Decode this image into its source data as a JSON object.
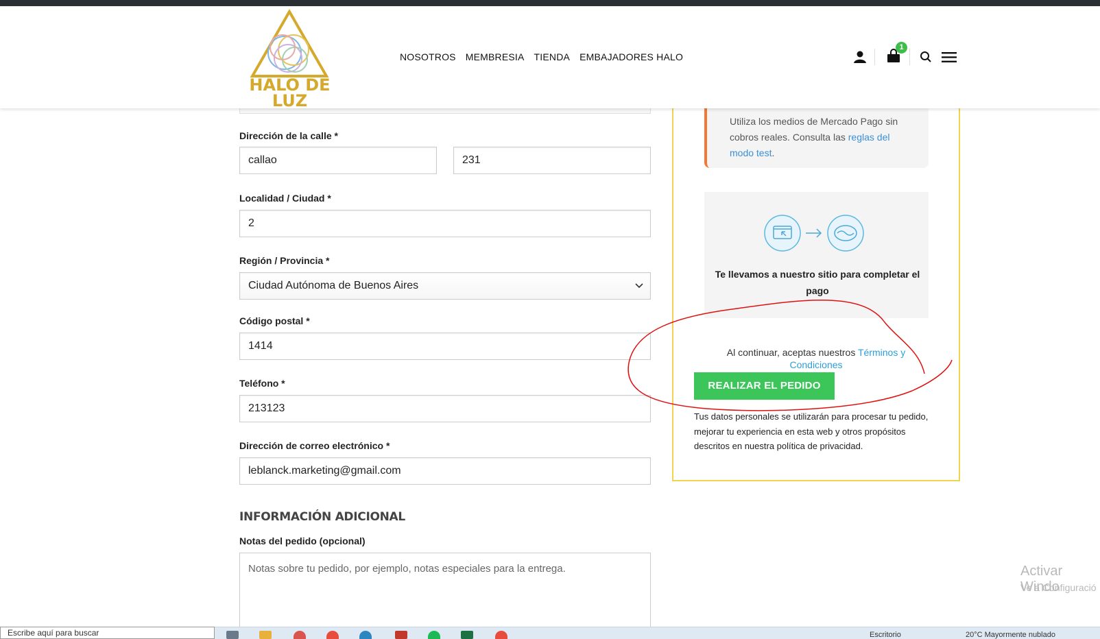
{
  "header": {
    "logo_line1": "HALO DE",
    "logo_line2": "LUZ",
    "nav": [
      "NOSOTROS",
      "MEMBRESIA",
      "TIENDA",
      "EMBAJADORES HALO"
    ],
    "cart_count": "1"
  },
  "form": {
    "street_label": "Dirección de la calle *",
    "street_value": "callao",
    "street_number_value": "231",
    "city_label": "Localidad / Ciudad *",
    "city_value": "2",
    "region_label": "Región / Provincia *",
    "region_value": "Ciudad Autónoma de Buenos Aires",
    "postcode_label": "Código postal *",
    "postcode_value": "1414",
    "phone_label": "Teléfono *",
    "phone_value": "213123",
    "email_label": "Dirección de correo electrónico *",
    "email_value": "leblanck.marketing@gmail.com",
    "additional_title": "INFORMACIÓN ADICIONAL",
    "notes_label": "Notas del pedido (opcional)",
    "notes_placeholder": "Notas sobre tu pedido, por ejemplo, notas especiales para la entrega."
  },
  "payment": {
    "test_text": "Utiliza los medios de Mercado Pago sin cobros reales. Consulta las ",
    "test_link": "reglas del modo test",
    "test_end": ".",
    "redirect_text": "Te llevamos a nuestro sitio para completar el pago",
    "terms_text": "Al continuar, aceptas nuestros ",
    "terms_link": "Términos y Condiciones",
    "place_order": "REALIZAR EL PEDIDO",
    "privacy": "Tus datos personales se utilizarán para procesar tu pedido, mejorar tu experiencia en esta web y otros propósitos descritos en nuestra política de privacidad."
  },
  "watermark": {
    "line1": "Activar Windo",
    "line2": "Ve a Configuració"
  },
  "taskbar": {
    "search": "Escribe aquí para buscar",
    "tray_text": "Escritorio",
    "weather": "20°C Mayormente nublado"
  },
  "colors": {
    "accent_green": "#3cc65a",
    "panel_border": "#f0d34e",
    "test_border": "#f27935",
    "link": "#2c9fd9",
    "logo_gold": "#d4a92c"
  }
}
